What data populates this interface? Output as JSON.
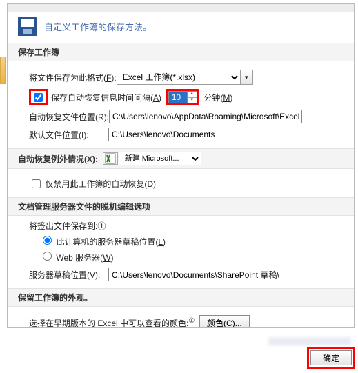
{
  "header": {
    "title": "自定义工作簿的保存方法。"
  },
  "sections": {
    "save_workbook": "保存工作簿",
    "autorecover_except": "自动恢复例外情况",
    "offline_edit": "文档管理服务器文件的脱机编辑选项",
    "compat": "保留工作簿的外观。"
  },
  "labels": {
    "save_format": "将文件保存为此格式",
    "save_format_key": "F",
    "autosave_interval": "保存自动恢复信息时间间隔",
    "autosave_key": "A",
    "minutes": "分钟",
    "minutes_key": "M",
    "autorecover_loc": "自动恢复文件位置",
    "autorecover_key": "R",
    "default_loc": "默认文件位置",
    "default_key": "I",
    "disable_autorecover": "仅禁用此工作簿的自动恢复",
    "disable_key": "D",
    "save_checkout_to": "将签出文件保存到",
    "opt_local_drafts": "此计算机的服务器草稿位置",
    "opt_local_key": "L",
    "opt_webserver": "Web 服务器",
    "opt_web_key": "W",
    "drafts_loc": "服务器草稿位置",
    "drafts_key": "V",
    "compat_text": "选择在早期版本的 Excel 中可以查看的颜色",
    "color_btn": "颜色",
    "color_key": "C",
    "new_microsoft": "新建 Microsoft...",
    "autorecover_key2": "X",
    "ok": "确定"
  },
  "values": {
    "format": "Excel 工作簿(*.xlsx)",
    "interval": "10",
    "autorecover_path": "C:\\Users\\lenovo\\AppData\\Roaming\\Microsoft\\Excel\\",
    "default_path": "C:\\Users\\lenovo\\Documents",
    "drafts_path": "C:\\Users\\lenovo\\Documents\\SharePoint 草稿\\",
    "int_underline": "①"
  }
}
